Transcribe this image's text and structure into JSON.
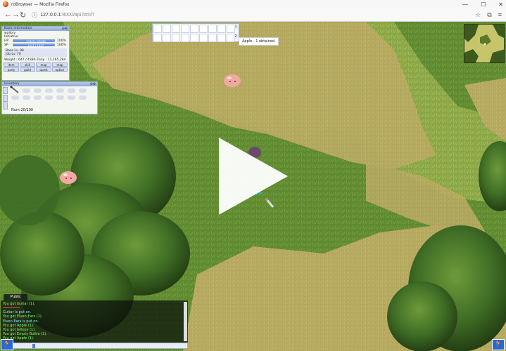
{
  "browser": {
    "title": "roBrowser — Mozilla Firefox",
    "url_host": "127.0.0.1",
    "url_path": ":8000/api.html?"
  },
  "basic_info": {
    "title": "Basic Information",
    "name": "wallory",
    "job": "Initiative",
    "hp_label": "HP",
    "hp_value": "10345 / 10345",
    "hp_pct": "100%",
    "hp_fill": 1.0,
    "sp_label": "SP",
    "sp_value": "1047 / 1047",
    "sp_pct": "100%",
    "sp_fill": 1.0,
    "base_lv": "Base Lv. 98",
    "job_lv": "Job Lv. 70",
    "weight": "Weight : 647 / 4380  Zeny : 11,265,284",
    "buttons": [
      "item",
      "skill",
      "map",
      "map",
      "party",
      "guild",
      "quest",
      "option"
    ]
  },
  "inventory": {
    "title": "Inventory",
    "count": "Num:20/100"
  },
  "hotbar": {
    "row_numbers": [
      "1",
      "2"
    ]
  },
  "notification": "Apple - 1 obtained.",
  "chat": {
    "tab": "Public",
    "lines": [
      {
        "text": "You got Guitar (1).",
        "color": "#7fff6a"
      },
      {
        "text": "",
        "color": "#ff3b3b"
      },
      {
        "text": "Guitar is put on.",
        "color": "#7fe6ff"
      },
      {
        "text": "You got Elven Ears (1).",
        "color": "#7fff6a"
      },
      {
        "text": "Elven Ears is put on.",
        "color": "#7fe6ff"
      },
      {
        "text": "You got Apple (1).",
        "color": "#7fff6a"
      },
      {
        "text": "You got Jellopy (1).",
        "color": "#7fff6a"
      },
      {
        "text": "You got Empty Bottle (1).",
        "color": "#7fff6a"
      },
      {
        "text": "You got Apple (1).",
        "color": "#7fff6a"
      }
    ]
  },
  "colors": {
    "grass_dark": "#4a7a2e",
    "grass_light": "#8fa94a",
    "dirt": "#b3a35a",
    "tree": "#2f5a1f",
    "poring": "#f0a5a0"
  }
}
